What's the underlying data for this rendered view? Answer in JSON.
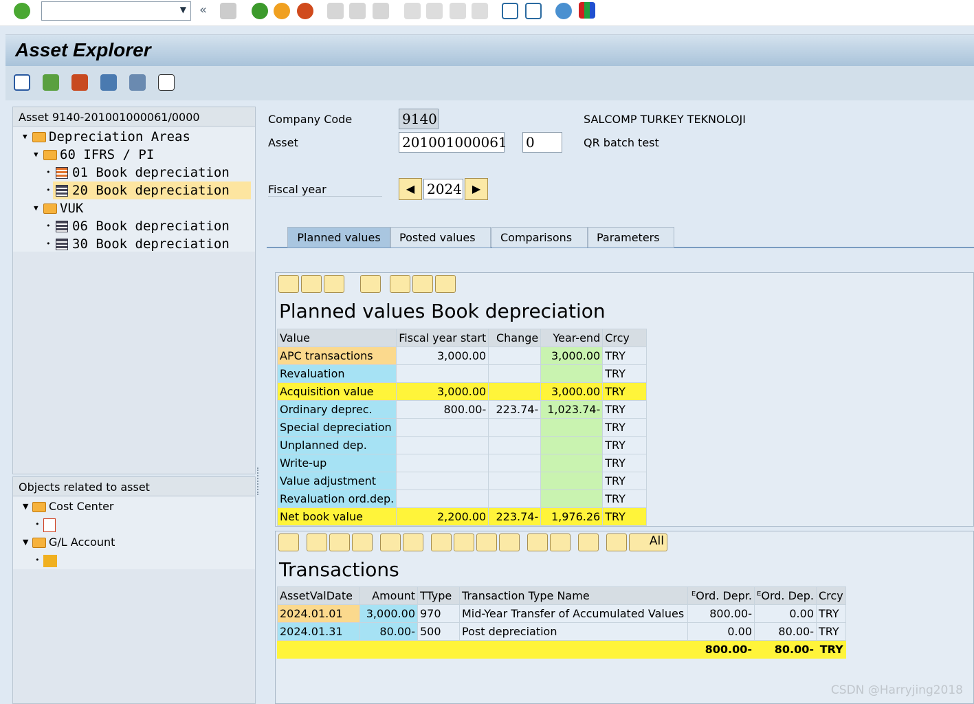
{
  "window": {
    "title": "Asset Explorer"
  },
  "system_toolbar": {
    "command_field": "",
    "icons": [
      "check-icon",
      "back-icon",
      "save-icon",
      "back-green-icon",
      "exit-icon",
      "cancel-icon",
      "print-icon",
      "find-icon",
      "find-next-icon",
      "first-page-icon",
      "prev-page-icon",
      "next-page-icon",
      "last-page-icon",
      "new-session-icon",
      "shortcut-icon",
      "help-icon",
      "customize-icon"
    ]
  },
  "app_toolbar": {
    "icons": [
      "refresh-icon",
      "layout-icon",
      "calc-icon",
      "chart-icon",
      "hierarchy-icon",
      "list-icon"
    ]
  },
  "tree": {
    "header": "Asset 9140-201001000061/0000",
    "items": [
      {
        "label": "Depreciation Areas",
        "level": 1
      },
      {
        "label": "60 IFRS / PI",
        "level": 2
      },
      {
        "label": "01 Book depreciation",
        "level": 3
      },
      {
        "label": "20 Book depreciation",
        "level": 3,
        "selected": true
      },
      {
        "label": "VUK",
        "level": 2
      },
      {
        "label": "06 Book depreciation",
        "level": 3
      },
      {
        "label": "30 Book depreciation",
        "level": 3
      }
    ]
  },
  "objects": {
    "header": "Objects related to asset",
    "items": [
      {
        "label": "Cost Center"
      },
      {
        "label": "G/L Account"
      }
    ]
  },
  "form": {
    "company_code_label": "Company Code",
    "company_code": "9140",
    "company_name": "SALCOMP TURKEY TEKNOLOJI",
    "asset_label": "Asset",
    "asset": "201001000061",
    "subnumber": "0",
    "asset_desc": "QR batch test",
    "fiscal_year_label": "Fiscal year",
    "fiscal_year": "2024"
  },
  "tabs": [
    {
      "label": "Planned values",
      "active": true
    },
    {
      "label": "Posted values"
    },
    {
      "label": "Comparisons"
    },
    {
      "label": "Parameters"
    }
  ],
  "planned": {
    "title": "Planned values Book depreciation",
    "headers": [
      "Value",
      "Fiscal year start",
      "Change",
      "Year-end",
      "Crcy"
    ],
    "rows": [
      [
        "APC transactions",
        "3,000.00",
        "",
        "3,000.00",
        "TRY"
      ],
      [
        "Revaluation",
        "",
        "",
        "",
        "TRY"
      ],
      [
        "Acquisition value",
        "3,000.00",
        "",
        "3,000.00",
        "TRY"
      ],
      [
        "Ordinary deprec.",
        "800.00-",
        "223.74-",
        "1,023.74-",
        "TRY"
      ],
      [
        "Special depreciation",
        "",
        "",
        "",
        "TRY"
      ],
      [
        "Unplanned dep.",
        "",
        "",
        "",
        "TRY"
      ],
      [
        "Write-up",
        "",
        "",
        "",
        "TRY"
      ],
      [
        "Value adjustment",
        "",
        "",
        "",
        "TRY"
      ],
      [
        "Revaluation ord.dep.",
        "",
        "",
        "",
        "TRY"
      ],
      [
        "Net book value",
        "2,200.00",
        "223.74-",
        "1,976.26",
        "TRY"
      ]
    ]
  },
  "transactions": {
    "title": "Transactions",
    "all_label": "All",
    "headers": [
      "AssetValDate",
      "Amount",
      "TType",
      "Transaction Type Name",
      "ᴱOrd. Depr.",
      "ᴱOrd. Dep.",
      "Crcy"
    ],
    "rows": [
      [
        "2024.01.01",
        "3,000.00",
        "970",
        "Mid-Year Transfer of Accumulated Values",
        "800.00-",
        "0.00",
        "TRY"
      ],
      [
        "2024.01.31",
        "80.00-",
        "500",
        "Post depreciation",
        "0.00",
        "80.00-",
        "TRY"
      ]
    ],
    "totals": {
      "ord_depr": "800.00-",
      "ord_dep": "80.00-",
      "crcy": "TRY"
    }
  },
  "watermark": "CSDN @Harryjing2018"
}
